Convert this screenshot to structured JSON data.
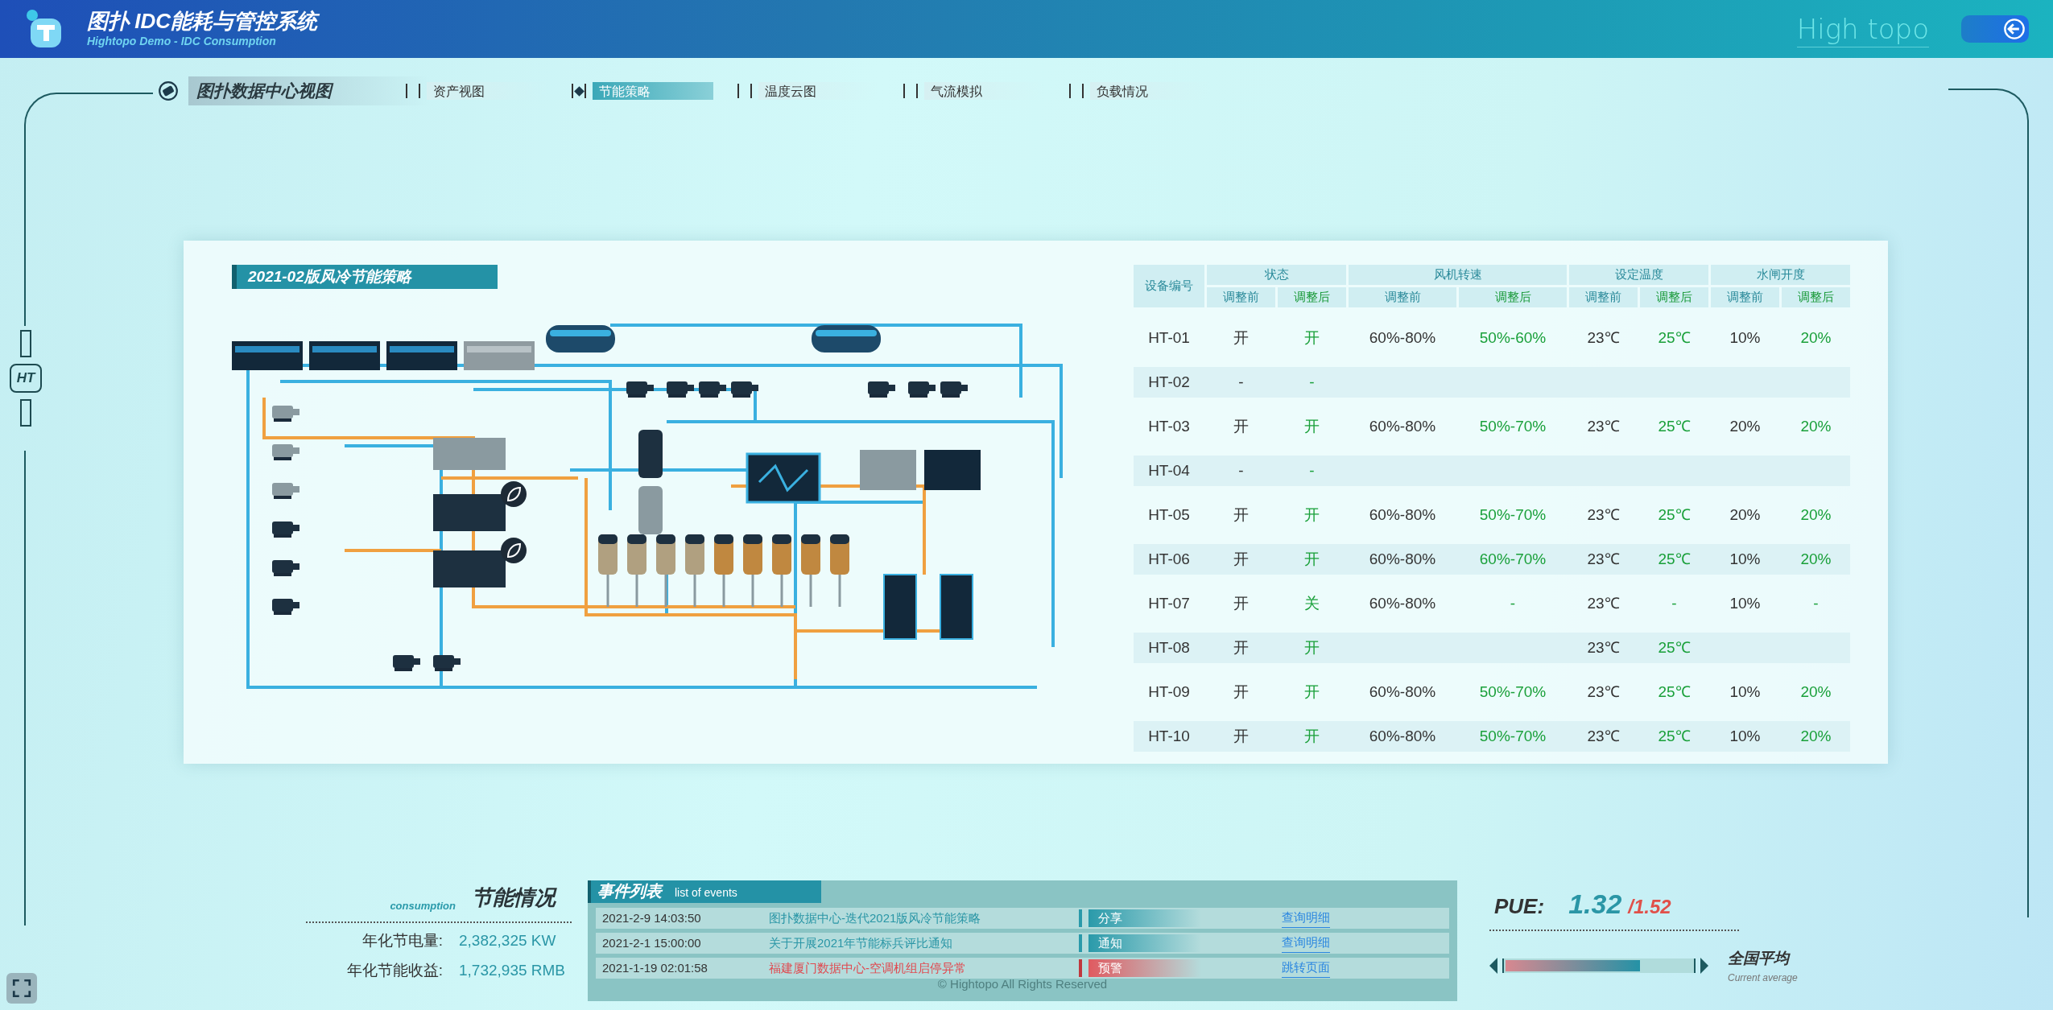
{
  "header": {
    "title": "图扑 IDC能耗与管控系统",
    "subtitle": "Hightopo Demo - IDC Consumption",
    "brand": "High topo"
  },
  "nav": {
    "view_title": "图扑数据中心视图",
    "tabs": [
      {
        "label": "资产视图",
        "selected": false
      },
      {
        "label": "节能策略",
        "selected": true
      },
      {
        "label": "温度云图",
        "selected": false
      },
      {
        "label": "气流模拟",
        "selected": false
      },
      {
        "label": "负载情况",
        "selected": false
      }
    ]
  },
  "side_badge": "HT",
  "strategy": {
    "title": "2021-02版风冷节能策略",
    "table": {
      "id_column": "设备编号",
      "groups": [
        {
          "label": "状态",
          "sub": [
            "调整前",
            "调整后"
          ]
        },
        {
          "label": "风机转速",
          "sub": [
            "调整前",
            "调整后"
          ]
        },
        {
          "label": "设定温度",
          "sub": [
            "调整前",
            "调整后"
          ]
        },
        {
          "label": "水闸开度",
          "sub": [
            "调整前",
            "调整后"
          ]
        }
      ],
      "rows": [
        {
          "id": "HT-01",
          "cells": [
            "开",
            "开",
            "60%-80%",
            "50%-60%",
            "23℃",
            "25℃",
            "10%",
            "20%"
          ]
        },
        {
          "id": "HT-02",
          "cells": [
            "-",
            "-",
            null,
            null,
            null,
            null,
            null,
            null
          ]
        },
        {
          "id": "HT-03",
          "cells": [
            "开",
            "开",
            "60%-80%",
            "50%-70%",
            "23℃",
            "25℃",
            "20%",
            "20%"
          ]
        },
        {
          "id": "HT-04",
          "cells": [
            "-",
            "-",
            null,
            null,
            null,
            null,
            null,
            null
          ]
        },
        {
          "id": "HT-05",
          "cells": [
            "开",
            "开",
            "60%-80%",
            "50%-70%",
            "23℃",
            "25℃",
            "20%",
            "20%"
          ]
        },
        {
          "id": "HT-06",
          "cells": [
            "开",
            "开",
            "60%-80%",
            "60%-70%",
            "23℃",
            "25℃",
            "10%",
            "20%"
          ]
        },
        {
          "id": "HT-07",
          "cells": [
            "开",
            "关",
            "60%-80%",
            "-",
            "23℃",
            "-",
            "10%",
            "-"
          ]
        },
        {
          "id": "HT-08",
          "cells": [
            "开",
            "开",
            null,
            null,
            "23℃",
            "25℃",
            null,
            null
          ]
        },
        {
          "id": "HT-09",
          "cells": [
            "开",
            "开",
            "60%-80%",
            "50%-70%",
            "23℃",
            "25℃",
            "10%",
            "20%"
          ]
        },
        {
          "id": "HT-10",
          "cells": [
            "开",
            "开",
            "60%-80%",
            "50%-70%",
            "23℃",
            "25℃",
            "10%",
            "20%"
          ]
        }
      ]
    }
  },
  "consumption": {
    "label_en": "consumption",
    "title": "节能情况",
    "items": [
      {
        "label": "年化节电量:",
        "value": "2,382,325 KW"
      },
      {
        "label": "年化节能收益:",
        "value": "1,732,935 RMB"
      }
    ]
  },
  "events": {
    "title": "事件列表",
    "subtitle": "list of events",
    "rows": [
      {
        "time": "2021-2-9 14:03:50",
        "text": "图扑数据中心-迭代2021版风冷节能策略",
        "tag": "分享",
        "kind": "info",
        "link": "查询明细"
      },
      {
        "time": "2021-2-1 15:00:00",
        "text": "关于开展2021年节能标兵评比通知",
        "tag": "通知",
        "kind": "info",
        "link": "查询明细"
      },
      {
        "time": "2021-1-19 02:01:58",
        "text": "福建厦门数据中心-空调机组启停异常",
        "tag": "预警",
        "kind": "alert",
        "link": "跳转页面"
      }
    ]
  },
  "pue": {
    "label": "PUE:",
    "value": "1.32",
    "target": "/1.52",
    "level": 0.72,
    "avg_title": "全国平均",
    "avg_sub": "Current average"
  },
  "footer": "© Hightopo All Rights Reserved"
}
